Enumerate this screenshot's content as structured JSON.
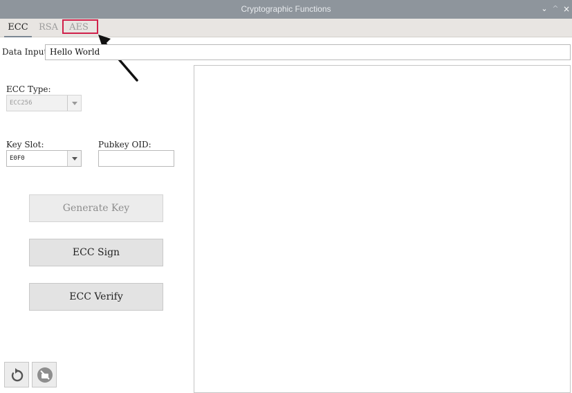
{
  "window": {
    "title": "Cryptographic Functions",
    "controls": {
      "minimize": "⌄",
      "maximize": "^",
      "close": "×"
    }
  },
  "tabs": [
    {
      "label": "ECC",
      "active": true
    },
    {
      "label": "RSA",
      "active": false
    },
    {
      "label": "AES",
      "active": false
    }
  ],
  "data_input": {
    "label": "Data Input:",
    "value": "Hello World"
  },
  "ecc_type": {
    "label": "ECC Type:",
    "value": "ECC256",
    "enabled": false
  },
  "key_slot": {
    "label": "Key Slot:",
    "value": "E0F0"
  },
  "pubkey_oid": {
    "label": "Pubkey OID:",
    "value": ""
  },
  "buttons": {
    "generate_key": "Generate Key",
    "ecc_sign": "ECC Sign",
    "ecc_verify": "ECC Verify"
  },
  "icons": {
    "reset": "reset-icon",
    "clear": "clear-icon"
  },
  "colors": {
    "highlight": "#d0204a",
    "titlebar": "#8e959c",
    "tabbar": "#e8e5e2"
  }
}
